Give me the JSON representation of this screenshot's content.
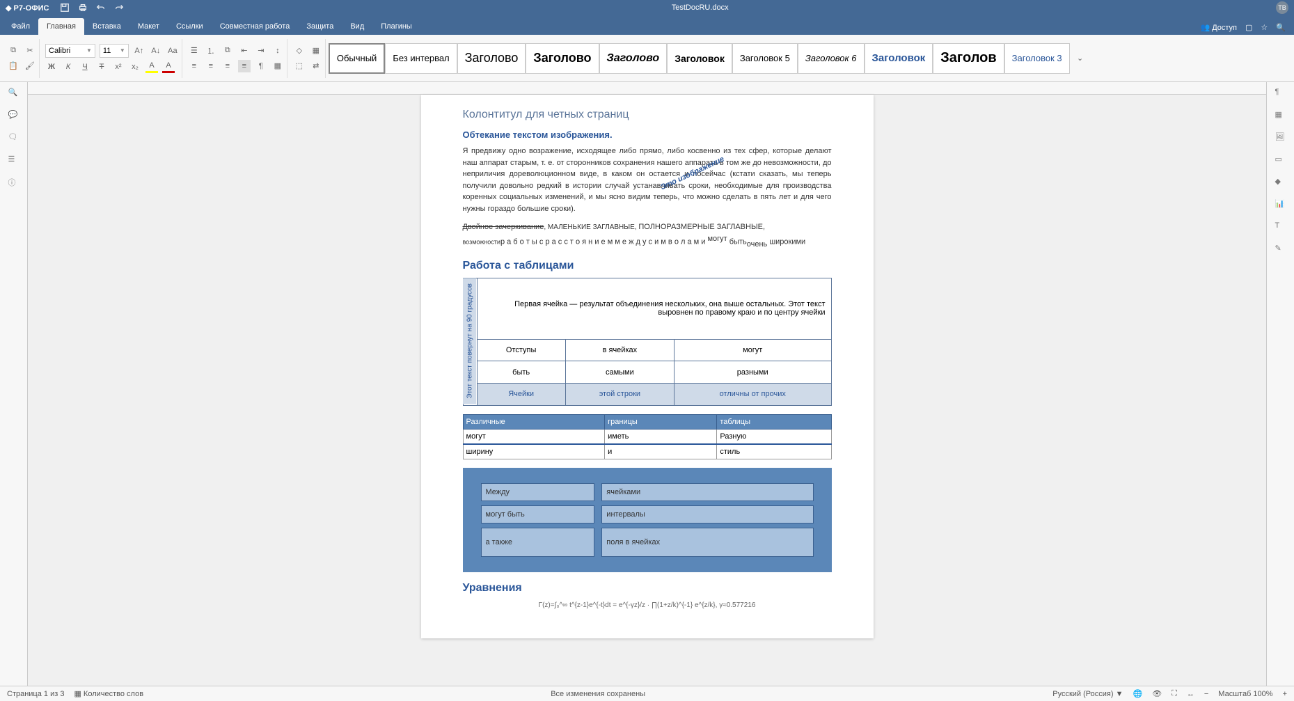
{
  "app": {
    "name": "Р7-ОФИС",
    "doc": "TestDocRU.docx",
    "avatar": "ТВ"
  },
  "menu": {
    "tabs": [
      "Файл",
      "Главная",
      "Вставка",
      "Макет",
      "Ссылки",
      "Совместная работа",
      "Защита",
      "Вид",
      "Плагины"
    ],
    "active": 1,
    "access": "Доступ"
  },
  "font": {
    "name": "Calibri",
    "size": "11"
  },
  "styles": [
    "Обычный",
    "Без интервал",
    "Заголово",
    "Заголово",
    "Заголово",
    "Заголовок",
    "Заголовок 5",
    "Заголовок 6",
    "Заголовок",
    "Заголов",
    "Заголовок 3"
  ],
  "doc": {
    "header": "Колонтитул для четных страниц",
    "s1": "Обтекание текстом изображения.",
    "body1": "Я предвижу одно возражение, исходящее либо прямо, либо косвенно из тех сфер, которые делают наш аппарат старым, т. е. от сторонников сохранения               нашего аппарата в том же до невозможности, до неприличия дореволюционном                   виде, в каком он остается и посейчас (кстати сказать, мы теперь получили                         довольно редкий в истории случай устанавливать сроки, необходимые для                      производства коренных социальных изменений, и мы ясно видим теперь, что           можно сделать в пять лет и для чего нужны гораздо большие сроки).",
    "rot": "Это изображение",
    "line2a": "Двойное зачеркивание",
    "line2b": ", МАЛЕНЬКИЕ ЗАГЛАВНЫЕ, ",
    "line2c": "ПОЛНОРАЗМЕРНЫЕ ЗАГЛАВНЫЕ,",
    "line3a": "возможности",
    "line3b": "р а б о т ы   с   р а с с т о я н и е м   м е ж д у   с и м в о л а м и ",
    "line3c": "могут",
    "line3d": " быть",
    "line3e": "очень",
    "line3f": " широкими",
    "s2": "Работа с таблицами",
    "t1": {
      "rot": "Этот текст повернут на 90 градусов",
      "merged": "Первая ячейка — результат объединения нескольких, она выше остальных. Этот текст выровнен по правому краю и по центру ячейки",
      "r2": [
        "Отступы",
        "в ячейках",
        "могут"
      ],
      "r3": [
        "быть",
        "самыми",
        "разными"
      ],
      "r4": [
        "Ячейки",
        "этой строки",
        "отличны от прочих"
      ]
    },
    "t2": {
      "h": [
        "Различные",
        "границы",
        "таблицы"
      ],
      "r1": [
        "могут",
        "иметь",
        "Разную"
      ],
      "r2": [
        "ширину",
        "и",
        "стиль"
      ]
    },
    "t3": {
      "r1": [
        "Между",
        "ячейками"
      ],
      "r2": [
        "могут быть",
        "интервалы"
      ],
      "r3": [
        "а также",
        "поля в ячейках"
      ]
    },
    "s3": "Уравнения",
    "eq": "Γ(z)=∫₀^∞ t^{z-1}e^{-t}dt = e^{-γz}/z · ∏(1+z/k)^{-1} e^{z/k},  γ≈0.577216"
  },
  "status": {
    "page": "Страница 1 из 3",
    "words": "Количество слов",
    "saved": "Все изменения сохранены",
    "lang": "Русский (Россия)",
    "zoom": "Масштаб 100%"
  }
}
